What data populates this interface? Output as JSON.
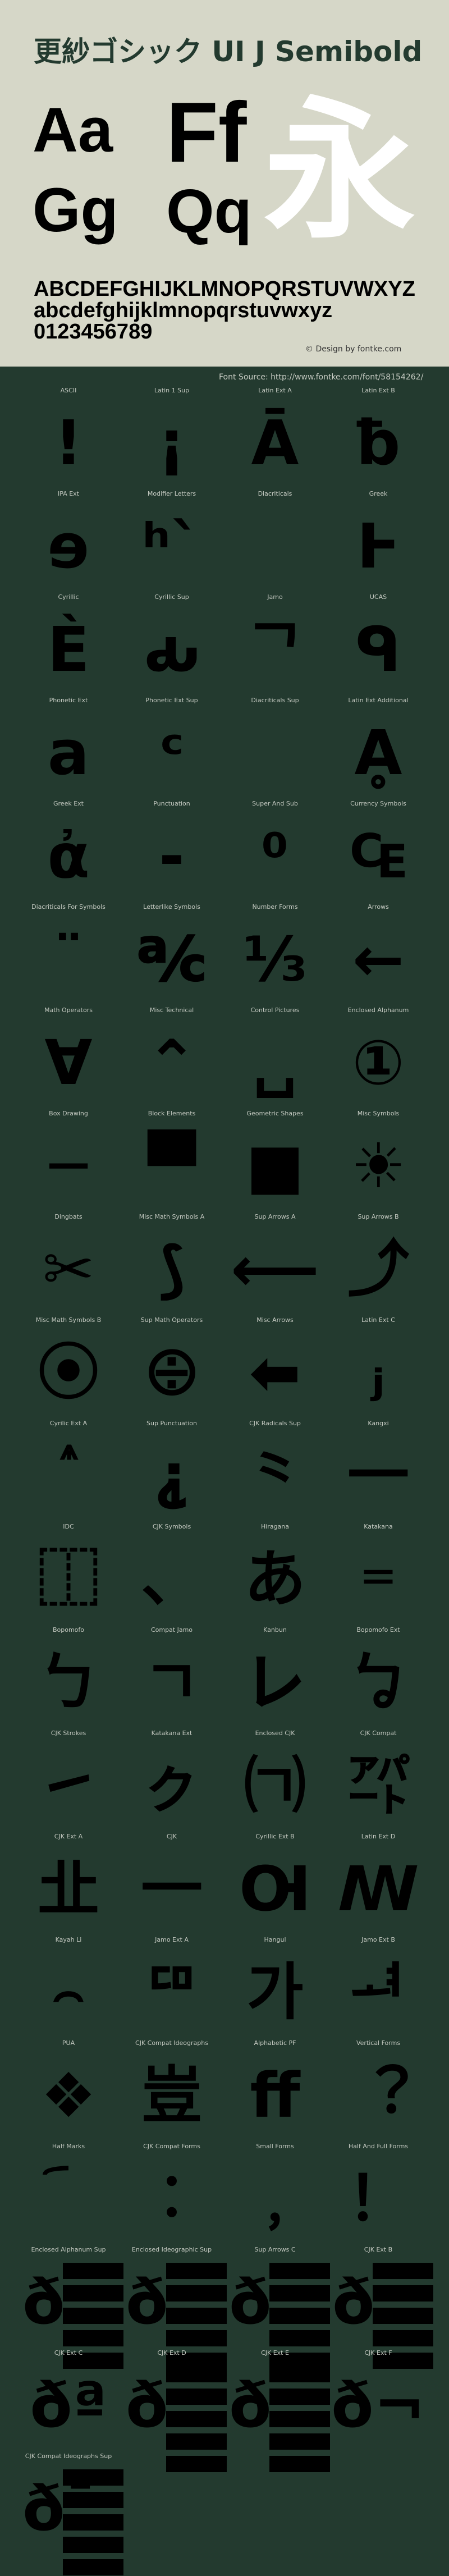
{
  "header": {
    "title": "更紗ゴシック UI J Semibold",
    "sample_aa": "Aa",
    "sample_ff": "Ff",
    "sample_gg": "Gg",
    "sample_qq": "Qq",
    "sample_kanji": "永",
    "uppercase": "ABCDEFGHIJKLMNOPQRSTUVWXYZ",
    "lowercase": "abcdefghijklmnopqrstuvwxyz",
    "digits": "0123456789",
    "credit": "© Design by fontke.com"
  },
  "source": "Font Source: http://www.fontke.com/font/58154262/",
  "colors": {
    "header_bg": "#d6d7c8",
    "body_bg": "#233a2f",
    "title": "#233a2f"
  },
  "cells": [
    {
      "label": "ASCII",
      "glyph": "!"
    },
    {
      "label": "Latin 1 Sup",
      "glyph": "¡"
    },
    {
      "label": "Latin Ext A",
      "glyph": "Ā"
    },
    {
      "label": "Latin Ext B",
      "glyph": "ƀ"
    },
    {
      "label": "IPA Ext",
      "glyph": "ɘ"
    },
    {
      "label": "Modifier Letters",
      "glyph": "ʰˋ"
    },
    {
      "label": "Diacriticals",
      "glyph": ""
    },
    {
      "label": "Greek",
      "glyph": "Ͱ"
    },
    {
      "label": "Cyrillic",
      "glyph": "Ѐ"
    },
    {
      "label": "Cyrillic Sup",
      "glyph": "ԃ"
    },
    {
      "label": "Jamo",
      "glyph": "ᄀ"
    },
    {
      "label": "UCAS",
      "glyph": "ᑫ"
    },
    {
      "label": "Phonetic Ext",
      "glyph": "a"
    },
    {
      "label": "Phonetic Ext Sup",
      "glyph": "ᶜ"
    },
    {
      "label": "Diacriticals Sup",
      "glyph": ""
    },
    {
      "label": "Latin Ext Additional",
      "glyph": "Ḁ"
    },
    {
      "label": "Greek Ext",
      "glyph": "ἀ"
    },
    {
      "label": "Punctuation",
      "glyph": "‐"
    },
    {
      "label": "Super And Sub",
      "glyph": "⁰"
    },
    {
      "label": "Currency Symbols",
      "glyph": "₠"
    },
    {
      "label": "Diacriticals For Symbols",
      "glyph": "¨"
    },
    {
      "label": "Letterlike Symbols",
      "glyph": "℀"
    },
    {
      "label": "Number Forms",
      "glyph": "⅓"
    },
    {
      "label": "Arrows",
      "glyph": "←"
    },
    {
      "label": "Math Operators",
      "glyph": "∀"
    },
    {
      "label": "Misc Technical",
      "glyph": "⌃"
    },
    {
      "label": "Control Pictures",
      "glyph": "␣"
    },
    {
      "label": "Enclosed Alphanum",
      "glyph": "①"
    },
    {
      "label": "Box Drawing",
      "glyph": "─"
    },
    {
      "label": "Block Elements",
      "glyph": "▀"
    },
    {
      "label": "Geometric Shapes",
      "glyph": "■"
    },
    {
      "label": "Misc Symbols",
      "glyph": "☀"
    },
    {
      "label": "Dingbats",
      "glyph": "✂"
    },
    {
      "label": "Misc Math Symbols A",
      "glyph": "⟆"
    },
    {
      "label": "Sup Arrows A",
      "glyph": "⟵"
    },
    {
      "label": "Sup Arrows B",
      "glyph": "⤴"
    },
    {
      "label": "Misc Math Symbols B",
      "glyph": "⦿"
    },
    {
      "label": "Sup Math Operators",
      "glyph": "⨸"
    },
    {
      "label": "Misc Arrows",
      "glyph": "⬅"
    },
    {
      "label": "Latin Ext C",
      "glyph": "ⱼ"
    },
    {
      "label": "Cyrilic Ext A",
      "glyph": "ⷽ"
    },
    {
      "label": "Sup Punctuation",
      "glyph": "⸘"
    },
    {
      "label": "CJK Radicals Sup",
      "glyph": "⺀"
    },
    {
      "label": "Kangxi",
      "glyph": "⼀"
    },
    {
      "label": "IDC",
      "glyph": "⿰"
    },
    {
      "label": "CJK Symbols",
      "glyph": "、"
    },
    {
      "label": "Hiragana",
      "glyph": "あ"
    },
    {
      "label": "Katakana",
      "glyph": "゠"
    },
    {
      "label": "Bopomofo",
      "glyph": "ㄅ"
    },
    {
      "label": "Compat Jamo",
      "glyph": "ㄱ"
    },
    {
      "label": "Kanbun",
      "glyph": "㆑"
    },
    {
      "label": "Bopomofo Ext",
      "glyph": "ㆠ"
    },
    {
      "label": "CJK Strokes",
      "glyph": "㇀"
    },
    {
      "label": "Katakana Ext",
      "glyph": "ㇰ"
    },
    {
      "label": "Enclosed CJK",
      "glyph": "㈀"
    },
    {
      "label": "CJK Compat",
      "glyph": "㌀"
    },
    {
      "label": "CJK Ext A",
      "glyph": "㐀"
    },
    {
      "label": "CJK",
      "glyph": "一"
    },
    {
      "label": "Cyrillic Ext B",
      "glyph": "Ꙕ"
    },
    {
      "label": "Latin Ext D",
      "glyph": "ꟿ"
    },
    {
      "label": "Kayah Li",
      "glyph": "꤮"
    },
    {
      "label": "Jamo Ext A",
      "glyph": "ꥠ"
    },
    {
      "label": "Hangul",
      "glyph": "가"
    },
    {
      "label": "Jamo Ext B",
      "glyph": "ힰ"
    },
    {
      "label": "PUA",
      "glyph": "❖"
    },
    {
      "label": "CJK Compat Ideographs",
      "glyph": "豈"
    },
    {
      "label": "Alphabetic PF",
      "glyph": "ﬀ"
    },
    {
      "label": "Vertical Forms",
      "glyph": "︖"
    },
    {
      "label": "Half Marks",
      "glyph": "︠"
    },
    {
      "label": "CJK Compat Forms",
      "glyph": "︰"
    },
    {
      "label": "Small Forms",
      "glyph": "﹐"
    },
    {
      "label": "Half And Full Forms",
      "glyph": "！"
    },
    {
      "label": "Enclosed Alphanum Sup",
      "glyph": "ð",
      "tofu": true
    },
    {
      "label": "Enclosed Ideographic Sup",
      "glyph": "ð",
      "tofu": true
    },
    {
      "label": "Sup Arrows C",
      "glyph": "ð",
      "tofu": true
    },
    {
      "label": "CJK Ext B",
      "glyph": "ð",
      "tofu": true
    },
    {
      "label": "CJK Ext C",
      "glyph": "ðª"
    },
    {
      "label": "CJK Ext D",
      "glyph": "ð",
      "tofu": true
    },
    {
      "label": "CJK Ext E",
      "glyph": "ð",
      "tofu": true
    },
    {
      "label": "CJK Ext F",
      "glyph": "ð¬"
    },
    {
      "label": "CJK Compat Ideographs Sup",
      "glyph": "ð¯",
      "tofu": true
    }
  ]
}
